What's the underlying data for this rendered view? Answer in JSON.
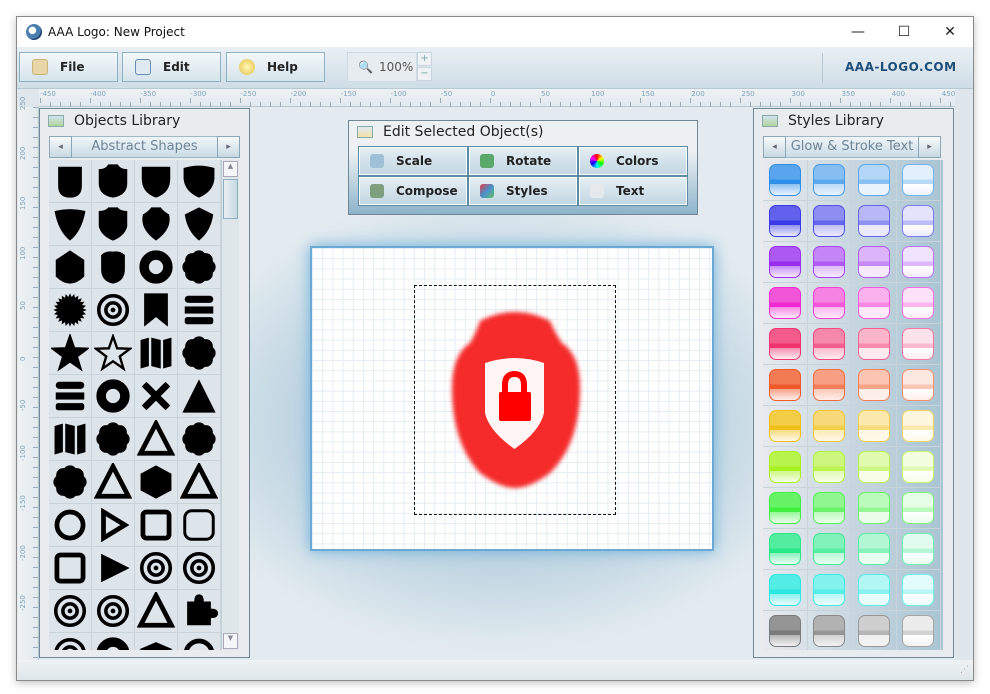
{
  "window": {
    "title": "AAA Logo: New Project",
    "minimize": "—",
    "maximize": "☐",
    "close": "✕"
  },
  "toolbar": {
    "file": "File",
    "edit": "Edit",
    "help": "Help",
    "zoom": "100%",
    "zoom_in": "+",
    "zoom_out": "−",
    "brand": "AAA-LOGO.COM"
  },
  "rulers": {
    "top": [
      "-450",
      "-400",
      "-350",
      "-300",
      "-250",
      "-200",
      "-150",
      "-100",
      "-50",
      "0",
      "50",
      "100",
      "150",
      "200",
      "250",
      "300",
      "350",
      "400",
      "450"
    ],
    "left": [
      "250",
      "200",
      "150",
      "100",
      "50",
      "0",
      "-50",
      "-100",
      "-150",
      "-200",
      "-250"
    ]
  },
  "objects_library": {
    "title": "Objects Library",
    "category": "Abstract Shapes",
    "prev": "◂",
    "next": "▸",
    "shapes": [
      "shield-tall",
      "shield-badge",
      "shield-round",
      "shield-wide",
      "shield-v",
      "shield-badge2",
      "shield-crest",
      "shield-kite",
      "pentagon",
      "shield-crest2",
      "donut",
      "flower",
      "starburst",
      "crescents",
      "bookmark",
      "burger",
      "star-nautical",
      "star-outline",
      "map",
      "pinwheel",
      "cylinder",
      "ring-c",
      "x-mark",
      "pyramid",
      "blocks",
      "flower-petals",
      "triangle-loop",
      "trefoil",
      "scallop",
      "arrow-frame",
      "hexa-cube",
      "drive",
      "ring",
      "play-outline",
      "square-outline",
      "square-rounded",
      "square-thin",
      "play-solid",
      "spiral-rings",
      "target-cross",
      "target",
      "crosshair",
      "link-s",
      "puzzle",
      "compass",
      "ring-c2",
      "mortarboard",
      "ring2"
    ]
  },
  "edit_panel": {
    "title": "Edit Selected Object(s)",
    "buttons": [
      "Scale",
      "Rotate",
      "Colors",
      "Compose",
      "Styles",
      "Text"
    ]
  },
  "styles_library": {
    "title": "Styles Library",
    "category": "Glow & Stroke Text",
    "prev": "◂",
    "next": "▸",
    "rows": [
      "#2f8fe8",
      "#3a3ae8",
      "#9a2ef0",
      "#f02ad0",
      "#f0326e",
      "#f05a28",
      "#f0c018",
      "#a8f020",
      "#40f040",
      "#28e888",
      "#28e8e0",
      "#7a7a7a"
    ]
  },
  "logo": {
    "shield_color": "#f52a2a",
    "inner_color": "#fff5f5",
    "lock_color": "#ff0000"
  }
}
